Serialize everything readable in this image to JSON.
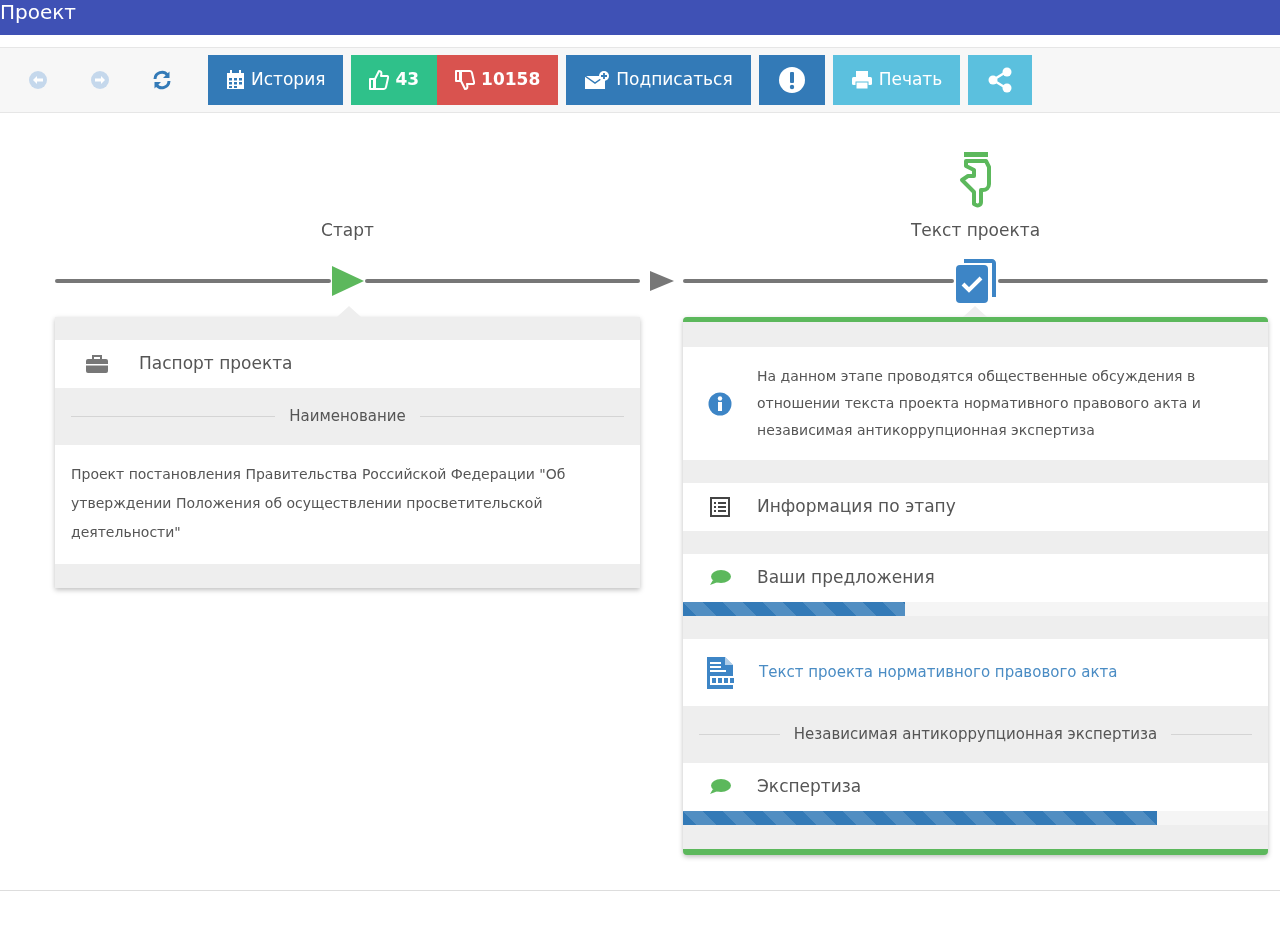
{
  "window": {
    "title": "Проект"
  },
  "toolbar": {
    "buttons": [
      {
        "kind": "back",
        "disabled": true
      },
      {
        "kind": "forward",
        "disabled": true
      },
      {
        "kind": "refresh",
        "disabled": false
      },
      {
        "kind": "history",
        "label": "История"
      },
      {
        "kind": "like",
        "label": "43"
      },
      {
        "kind": "dislike",
        "label": "10158"
      },
      {
        "kind": "subscribe",
        "label": "Подписаться"
      },
      {
        "kind": "report"
      },
      {
        "kind": "print",
        "label": "Печать"
      },
      {
        "kind": "share"
      }
    ]
  },
  "stages": [
    {
      "label": "Старт",
      "current": false,
      "items": [
        {
          "kind": "passport",
          "text": "Паспорт проекта"
        },
        {
          "kind": "heading",
          "text": "Наименование"
        },
        {
          "kind": "text",
          "text": "Проект постановления Правительства Российской Федерации \"Об утверждении Положения об осуществлении просветительской деятельности\""
        }
      ]
    },
    {
      "label": "Текст проекта",
      "current": true,
      "items": [
        {
          "kind": "notice",
          "text": "На данном этапе проводятся общественные обсуждения в отношении текста проекта нормативного правового акта и независимая антикоррупционная экспертиза"
        },
        {
          "kind": "stage-info",
          "text": "Информация по этапу"
        },
        {
          "kind": "discussion",
          "text": "Ваши предложения",
          "level": 0.38
        },
        {
          "kind": "document",
          "text": "Текст проекта нормативного правового акта"
        },
        {
          "kind": "heading",
          "text": "Независимая антикоррупционная экспертиза"
        },
        {
          "kind": "discussion",
          "text": "Экспертиза",
          "level": 0.81
        }
      ]
    }
  ]
}
